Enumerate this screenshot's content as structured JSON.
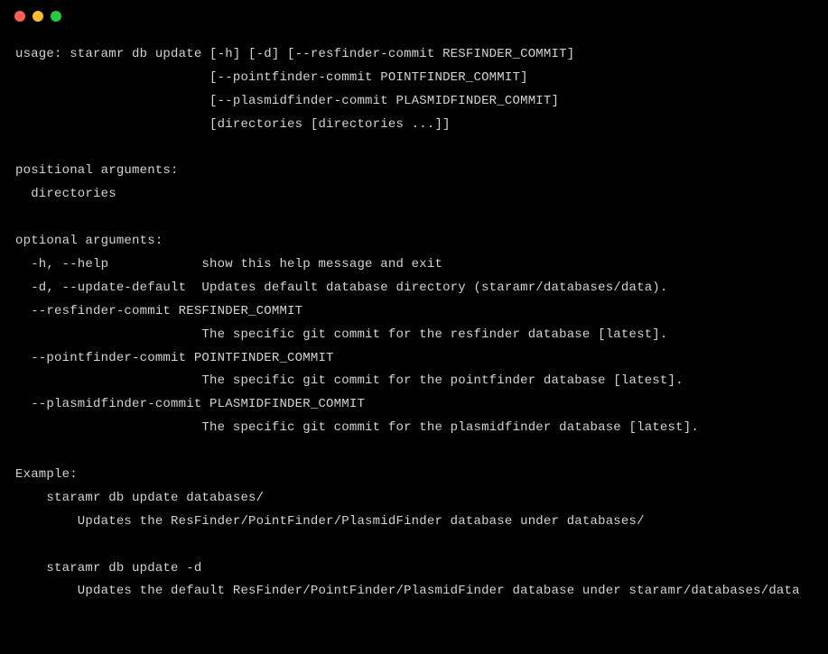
{
  "titlebar": {
    "buttons": [
      "close",
      "minimize",
      "maximize"
    ]
  },
  "terminal": {
    "lines": [
      "usage: staramr db update [-h] [-d] [--resfinder-commit RESFINDER_COMMIT]",
      "                         [--pointfinder-commit POINTFINDER_COMMIT]",
      "                         [--plasmidfinder-commit PLASMIDFINDER_COMMIT]",
      "                         [directories [directories ...]]",
      "",
      "positional arguments:",
      "  directories",
      "",
      "optional arguments:",
      "  -h, --help            show this help message and exit",
      "  -d, --update-default  Updates default database directory (staramr/databases/data).",
      "  --resfinder-commit RESFINDER_COMMIT",
      "                        The specific git commit for the resfinder database [latest].",
      "  --pointfinder-commit POINTFINDER_COMMIT",
      "                        The specific git commit for the pointfinder database [latest].",
      "  --plasmidfinder-commit PLASMIDFINDER_COMMIT",
      "                        The specific git commit for the plasmidfinder database [latest].",
      "",
      "Example:",
      "    staramr db update databases/",
      "        Updates the ResFinder/PointFinder/PlasmidFinder database under databases/",
      "",
      "    staramr db update -d",
      "        Updates the default ResFinder/PointFinder/PlasmidFinder database under staramr/databases/data"
    ]
  }
}
